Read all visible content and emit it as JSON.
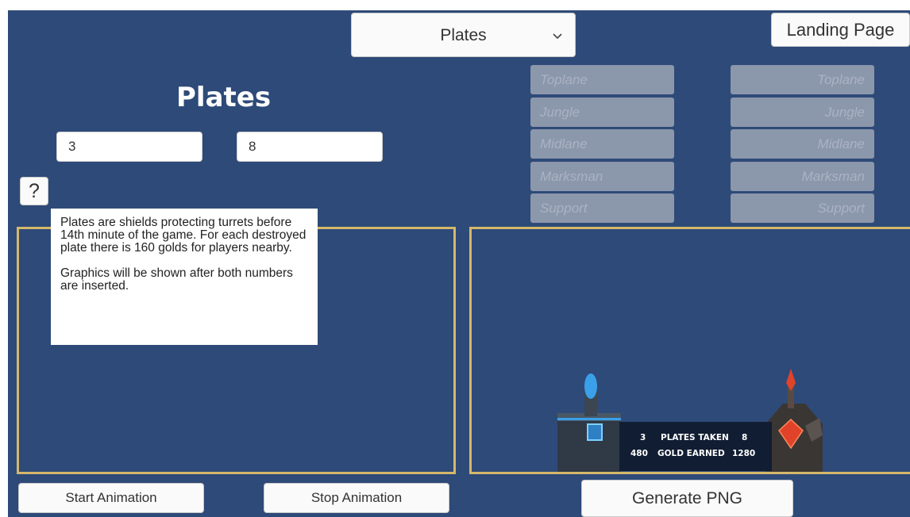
{
  "header": {
    "dropdown_selected": "Plates",
    "landing_page_label": "Landing Page"
  },
  "main": {
    "title": "Plates",
    "left_value": "3",
    "right_value": "8",
    "help_label": "?",
    "tooltip": {
      "paragraph_1": "Plates are shields protecting turrets before 14th minute of the game. For each destroyed plate there is 160 golds for players nearby.",
      "paragraph_2": "Graphics will be shown after both numbers are inserted."
    }
  },
  "roles_left": [
    "Toplane",
    "Jungle",
    "Midlane",
    "Marksman",
    "Support"
  ],
  "roles_right": [
    "Toplane",
    "Jungle",
    "Midlane",
    "Marksman",
    "Support"
  ],
  "preview": {
    "plates_left": "3",
    "plates_label": "PLATES TAKEN",
    "plates_right": "8",
    "gold_left": "480",
    "gold_label": "GOLD EARNED",
    "gold_right": "1280"
  },
  "footer": {
    "start_label": "Start Animation",
    "stop_label": "Stop Animation",
    "generate_label": "Generate PNG"
  },
  "colors": {
    "background": "#2e4a78",
    "panel_border": "#d4b86a",
    "role_disabled": "#8b97ab",
    "blue_team": "#3aa0e8",
    "red_team": "#e0432a"
  }
}
